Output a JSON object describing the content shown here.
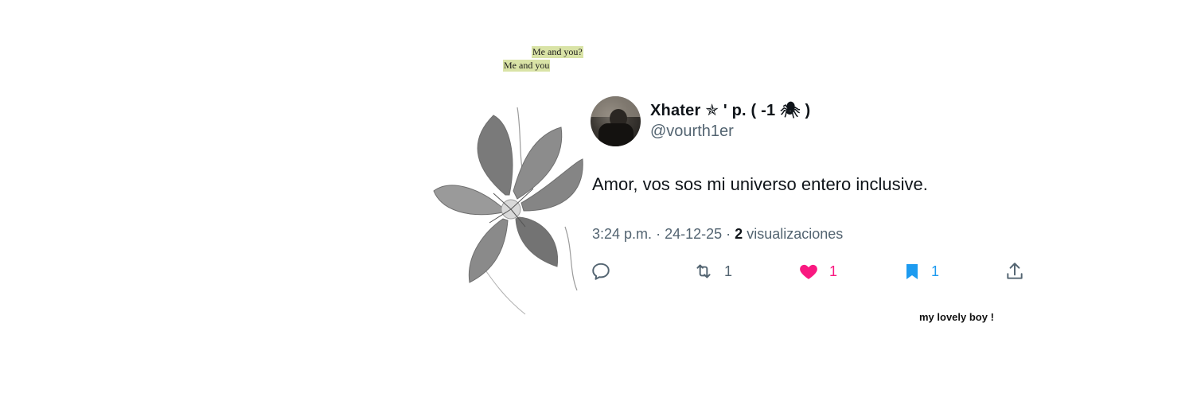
{
  "notes": {
    "top": "Me and you?",
    "bottom": "Me and you"
  },
  "tweet": {
    "display_name": "Xhater ✯ ' p. ( -1 🕷 )",
    "handle": "@vourth1er",
    "text": "Amor, vos sos mi universo entero inclusive.",
    "time": "3:24 p.m.",
    "separator": "·",
    "date": "24-12-25",
    "views_count": "2",
    "views_label": "visualizaciones",
    "actions": {
      "reply_icon": "reply-icon",
      "retweet_icon": "retweet-icon",
      "retweet_count": "1",
      "like_icon": "heart-icon",
      "like_count": "1",
      "bookmark_icon": "bookmark-icon",
      "bookmark_count": "1",
      "share_icon": "share-icon"
    }
  },
  "caption": "my lovely boy !",
  "colors": {
    "text_primary": "#0f1419",
    "text_secondary": "#536471",
    "like": "#f91880",
    "bookmark": "#1d9bf0",
    "highlight": "#d9e3a6"
  }
}
